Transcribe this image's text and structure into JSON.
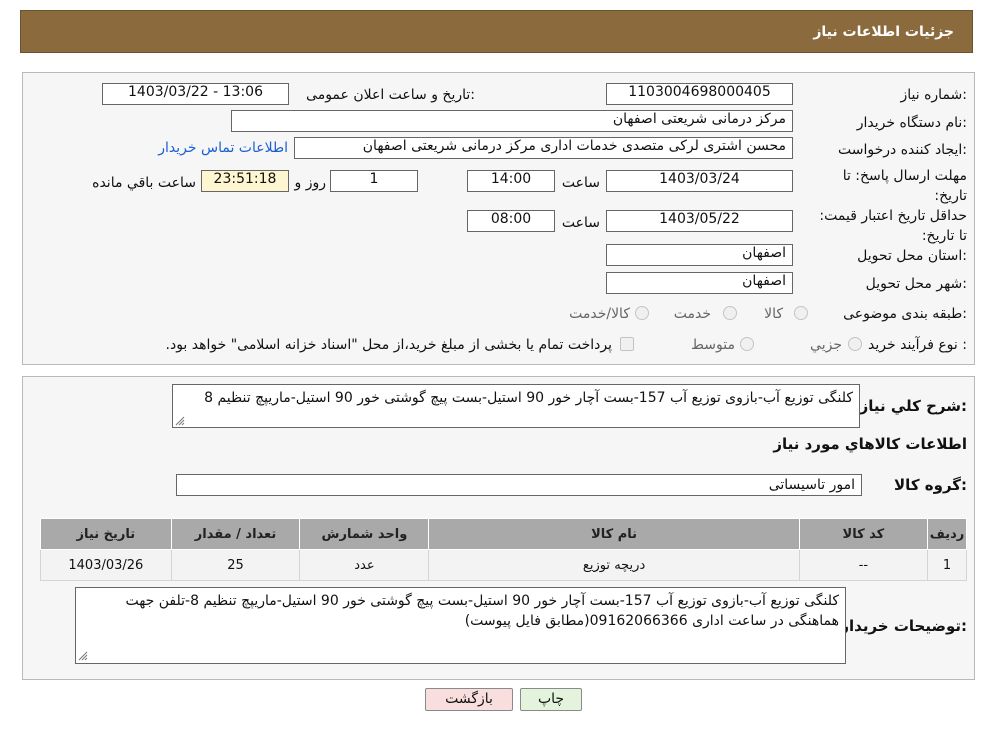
{
  "header": {
    "title": "جزئیات اطلاعات نیاز"
  },
  "form": {
    "need_number_label": "شماره نیاز:",
    "need_number": "1103004698000405",
    "announce_label": "تاریخ و ساعت اعلان عمومی:",
    "announce_value": "1403/03/22 - 13:06",
    "buyer_org_label": "نام دستگاه خریدار:",
    "buyer_org": "مرکز درمانی شریعتی اصفهان",
    "creator_label": "ایجاد کننده درخواست:",
    "creator": "محسن اشتری لرکی متصدی خدمات اداری مرکز درمانی شریعتی اصفهان",
    "contact_link": "اطلاعات تماس خریدار",
    "deadline_label": "مهلت ارسال پاسخ: تا تاریخ:",
    "deadline_date": "1403/03/24",
    "time_label": "ساعت",
    "deadline_time": "14:00",
    "days_value": "1",
    "days_label": "روز و",
    "remaining_time": "23:51:18",
    "remaining_label": "ساعت باقي مانده",
    "validity_label": "حداقل تاریخ اعتبار قیمت: تا تاریخ:",
    "validity_date": "1403/05/22",
    "validity_time": "08:00",
    "province_label": "استان محل تحویل:",
    "province": "اصفهان",
    "city_label": "شهر محل تحویل:",
    "city": "اصفهان",
    "category_label": "طبقه بندی موضوعی:",
    "category_options": [
      "کالا",
      "خدمت",
      "کالا/خدمت"
    ],
    "purchase_label": "نوع فرآیند خرید :",
    "purchase_options": [
      "جزیي",
      "متوسط"
    ],
    "purchase_note": "پرداخت تمام یا بخشی از مبلغ خرید،از محل \"اسناد خزانه اسلامی\" خواهد بود."
  },
  "details": {
    "summary_label": "شرح کلي نياز:",
    "summary_text": "کلنگی توزیع آب-بازوی توزیع آب 157-بست آچار خور 90 استیل-بست پیچ گوشتی خور 90 استیل-ماریپچ تنظیم 8",
    "goods_info_title": "اطلاعات کالاهاي مورد نياز",
    "goods_group_label": "گروه کالا:",
    "goods_group": "امور تاسیساتی",
    "table": {
      "headers": [
        "رديف",
        "کد کالا",
        "نام کالا",
        "واحد شمارش",
        "تعداد / مقدار",
        "تاریخ نیاز"
      ],
      "rows": [
        [
          "1",
          "--",
          "دریچه توزیع",
          "عدد",
          "25",
          "1403/03/26"
        ]
      ]
    },
    "buyer_notes_label": "توضیحات خریدار:",
    "buyer_notes": "کلنگی توزیع آب-بازوی توزیع آب 157-بست آچار خور 90 استیل-بست پیچ گوشتی خور 90 استیل-ماریپچ تنظیم 8-تلفن جهت هماهنگی در ساعت اداری 09162066366(مطابق فایل پیوست)"
  },
  "buttons": {
    "print": "چاپ",
    "back": "بازگشت"
  },
  "colors": {
    "header_bg": "#8b6b3d",
    "table_header": "#a9a9a9",
    "back_button_bg": "#f9dede",
    "print_button_bg": "#e4f4dc",
    "link": "#1a5fd1"
  },
  "watermark_icon": "aria-tender-logo"
}
